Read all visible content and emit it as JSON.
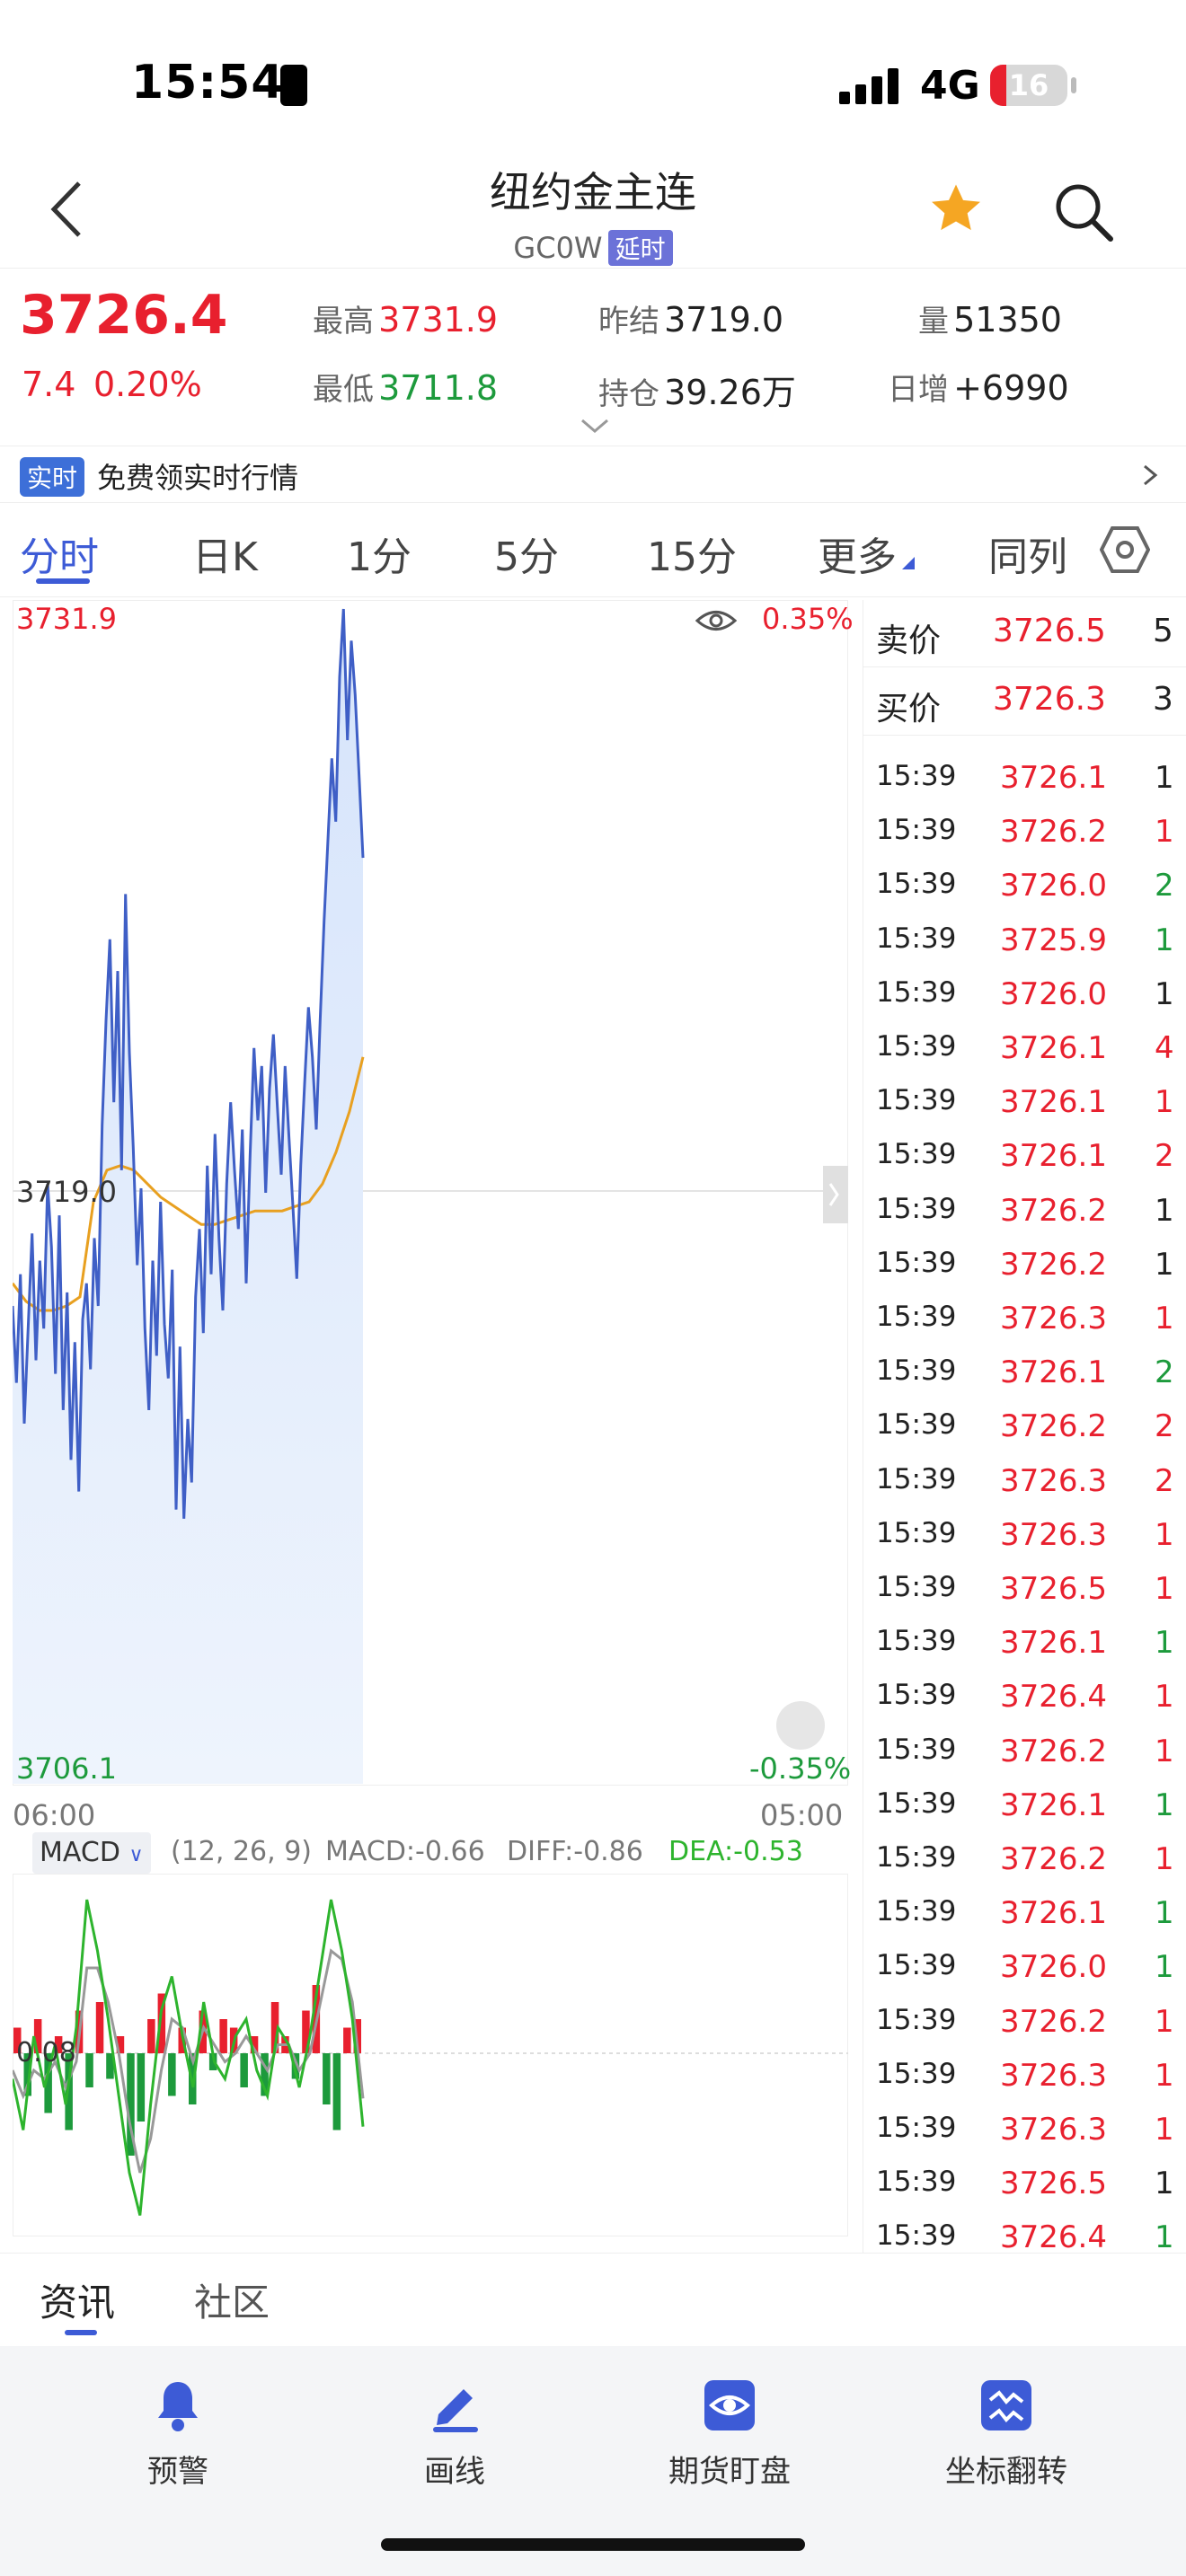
{
  "status_bar": {
    "time": "15:54",
    "network": "4G",
    "battery": "16"
  },
  "header": {
    "title": "纽约金主连",
    "code": "GC0W",
    "delay_tag": "延时"
  },
  "quote": {
    "last": "3726.4",
    "change": "7.4",
    "change_pct": "0.20%",
    "high_label": "最高",
    "high": "3731.9",
    "low_label": "最低",
    "low": "3711.8",
    "prev_settle_label": "昨结",
    "prev_settle": "3719.0",
    "open_interest_label": "持仓",
    "open_interest": "39.26万",
    "volume_label": "量",
    "volume": "51350",
    "daily_add_label": "日增",
    "daily_add": "+6990"
  },
  "realtime_banner": {
    "tag": "实时",
    "text": "免费领实时行情"
  },
  "tabs": [
    "分时",
    "日K",
    "1分",
    "5分",
    "15分",
    "更多",
    "同列"
  ],
  "chart": {
    "top_price": "3731.9",
    "top_pct": "0.35%",
    "mid_price": "3719.0",
    "bottom_price": "3706.1",
    "bottom_pct": "-0.35%",
    "start_time": "06:00",
    "end_time": "05:00",
    "macd_selector": "MACD",
    "macd_params": "(12, 26, 9)",
    "macd_value": "MACD:-0.66",
    "diff_value": "DIFF:-0.86",
    "dea_value": "DEA:-0.53",
    "macd_mid": "0.08"
  },
  "chart_data": {
    "type": "line",
    "title": "",
    "xlabel": "",
    "ylabel": "",
    "x_range": [
      "06:00",
      "05:00"
    ],
    "ylim": [
      3706.1,
      3731.9
    ],
    "reference": 3719.0,
    "series": [],
    "price_series": [
      3716.5,
      3714.8,
      3717.2,
      3713.9,
      3716.0,
      3718.1,
      3715.3,
      3717.5,
      3716.0,
      3719.2,
      3717.8,
      3715.0,
      3718.5,
      3714.2,
      3716.8,
      3713.1,
      3715.7,
      3712.4,
      3716.2,
      3717.0,
      3715.1,
      3718.0,
      3716.5,
      3720.5,
      3722.8,
      3724.6,
      3721.0,
      3723.9,
      3719.5,
      3725.6,
      3722.1,
      3720.0,
      3717.4,
      3719.1,
      3716.0,
      3714.2,
      3717.5,
      3715.4,
      3718.8,
      3716.1,
      3714.9,
      3717.3,
      3712.0,
      3715.6,
      3711.8,
      3714.0,
      3712.6,
      3716.7,
      3718.2,
      3715.9,
      3719.6,
      3717.2,
      3720.3,
      3718.0,
      3716.4,
      3719.2,
      3721.0,
      3719.5,
      3718.2,
      3720.4,
      3717.0,
      3719.8,
      3722.2,
      3720.6,
      3721.8,
      3719.0,
      3721.3,
      3722.5,
      3720.9,
      3719.4,
      3721.8,
      3720.2,
      3718.7,
      3717.1,
      3719.6,
      3721.4,
      3723.1,
      3722.0,
      3720.4,
      3722.8,
      3725.0,
      3726.8,
      3728.6,
      3727.2,
      3730.4,
      3731.9,
      3729.0,
      3731.2,
      3730.0,
      3728.2,
      3726.4
    ],
    "average_series": [
      3717.0,
      3716.6,
      3716.4,
      3716.4,
      3716.5,
      3716.7,
      3718.8,
      3719.5,
      3719.6,
      3719.5,
      3719.2,
      3718.9,
      3718.7,
      3718.5,
      3718.3,
      3718.3,
      3718.4,
      3718.5,
      3718.6,
      3718.6,
      3718.6,
      3718.7,
      3718.8,
      3719.2,
      3719.9,
      3720.8,
      3722.0
    ],
    "macd_hist": [
      0.3,
      -0.5,
      0.4,
      -0.7,
      0.2,
      -0.9,
      0.5,
      -0.4,
      0.6,
      -0.3,
      0.2,
      -1.2,
      -0.8,
      0.4,
      0.7,
      -0.5,
      0.3,
      -0.6,
      0.5,
      -0.2,
      0.4,
      0.3,
      -0.4,
      0.2,
      -0.5,
      0.6,
      0.2,
      -0.3,
      0.5,
      0.8,
      -0.6,
      -0.9,
      0.3,
      0.4
    ],
    "diff_series": [
      -0.3,
      -0.9,
      0.2,
      -0.4,
      0.1,
      -0.6,
      0.3,
      1.8,
      1.2,
      0.4,
      -0.5,
      -1.4,
      -1.9,
      -0.6,
      0.5,
      0.9,
      0.2,
      -0.4,
      0.6,
      -0.1,
      -0.3,
      0.2,
      0.4,
      -0.2,
      -0.5,
      0.3,
      0.1,
      -0.4,
      0.2,
      1.0,
      1.8,
      1.2,
      0.4,
      -0.86
    ],
    "dea_series": [
      -0.2,
      -0.5,
      -0.2,
      -0.3,
      -0.1,
      -0.4,
      -0.1,
      1.0,
      1.0,
      0.6,
      0.0,
      -0.8,
      -1.4,
      -1.0,
      -0.2,
      0.4,
      0.3,
      -0.1,
      0.3,
      0.1,
      -0.1,
      0.0,
      0.2,
      0.0,
      -0.2,
      0.1,
      0.1,
      -0.2,
      0.0,
      0.6,
      1.2,
      1.1,
      0.6,
      -0.53
    ]
  },
  "order_book": {
    "ask_label": "卖价",
    "ask_price": "3726.5",
    "ask_vol": "5",
    "bid_label": "买价",
    "bid_price": "3726.3",
    "bid_vol": "3",
    "trades": [
      {
        "time": "15:39",
        "price": "3726.1",
        "vol": "1",
        "pc": "red",
        "vc": "black"
      },
      {
        "time": "15:39",
        "price": "3726.2",
        "vol": "1",
        "pc": "red",
        "vc": "red"
      },
      {
        "time": "15:39",
        "price": "3726.0",
        "vol": "2",
        "pc": "red",
        "vc": "green"
      },
      {
        "time": "15:39",
        "price": "3725.9",
        "vol": "1",
        "pc": "red",
        "vc": "green"
      },
      {
        "time": "15:39",
        "price": "3726.0",
        "vol": "1",
        "pc": "red",
        "vc": "black"
      },
      {
        "time": "15:39",
        "price": "3726.1",
        "vol": "4",
        "pc": "red",
        "vc": "red"
      },
      {
        "time": "15:39",
        "price": "3726.1",
        "vol": "1",
        "pc": "red",
        "vc": "red"
      },
      {
        "time": "15:39",
        "price": "3726.1",
        "vol": "2",
        "pc": "red",
        "vc": "red"
      },
      {
        "time": "15:39",
        "price": "3726.2",
        "vol": "1",
        "pc": "red",
        "vc": "black"
      },
      {
        "time": "15:39",
        "price": "3726.2",
        "vol": "1",
        "pc": "red",
        "vc": "black"
      },
      {
        "time": "15:39",
        "price": "3726.3",
        "vol": "1",
        "pc": "red",
        "vc": "red"
      },
      {
        "time": "15:39",
        "price": "3726.1",
        "vol": "2",
        "pc": "red",
        "vc": "green"
      },
      {
        "time": "15:39",
        "price": "3726.2",
        "vol": "2",
        "pc": "red",
        "vc": "red"
      },
      {
        "time": "15:39",
        "price": "3726.3",
        "vol": "2",
        "pc": "red",
        "vc": "red"
      },
      {
        "time": "15:39",
        "price": "3726.3",
        "vol": "1",
        "pc": "red",
        "vc": "red"
      },
      {
        "time": "15:39",
        "price": "3726.5",
        "vol": "1",
        "pc": "red",
        "vc": "red"
      },
      {
        "time": "15:39",
        "price": "3726.1",
        "vol": "1",
        "pc": "red",
        "vc": "green"
      },
      {
        "time": "15:39",
        "price": "3726.4",
        "vol": "1",
        "pc": "red",
        "vc": "red"
      },
      {
        "time": "15:39",
        "price": "3726.2",
        "vol": "1",
        "pc": "red",
        "vc": "red"
      },
      {
        "time": "15:39",
        "price": "3726.1",
        "vol": "1",
        "pc": "red",
        "vc": "green"
      },
      {
        "time": "15:39",
        "price": "3726.2",
        "vol": "1",
        "pc": "red",
        "vc": "red"
      },
      {
        "time": "15:39",
        "price": "3726.1",
        "vol": "1",
        "pc": "red",
        "vc": "green"
      },
      {
        "time": "15:39",
        "price": "3726.0",
        "vol": "1",
        "pc": "red",
        "vc": "green"
      },
      {
        "time": "15:39",
        "price": "3726.2",
        "vol": "1",
        "pc": "red",
        "vc": "red"
      },
      {
        "time": "15:39",
        "price": "3726.3",
        "vol": "1",
        "pc": "red",
        "vc": "red"
      },
      {
        "time": "15:39",
        "price": "3726.3",
        "vol": "1",
        "pc": "red",
        "vc": "red"
      },
      {
        "time": "15:39",
        "price": "3726.5",
        "vol": "1",
        "pc": "red",
        "vc": "black"
      },
      {
        "time": "15:39",
        "price": "3726.4",
        "vol": "1",
        "pc": "red",
        "vc": "green"
      }
    ]
  },
  "sub_tabs": [
    "资讯",
    "社区"
  ],
  "bottom_nav": [
    {
      "label": "预警",
      "icon": "bell-icon"
    },
    {
      "label": "画线",
      "icon": "pen-icon"
    },
    {
      "label": "期货盯盘",
      "icon": "eye-icon"
    },
    {
      "label": "坐标翻转",
      "icon": "flip-icon"
    }
  ],
  "colors": {
    "up": "#e8202e",
    "down": "#1d9a3c",
    "accent": "#3d5bd6",
    "price_line": "#3f5fc6",
    "avg_line": "#e8a020"
  }
}
